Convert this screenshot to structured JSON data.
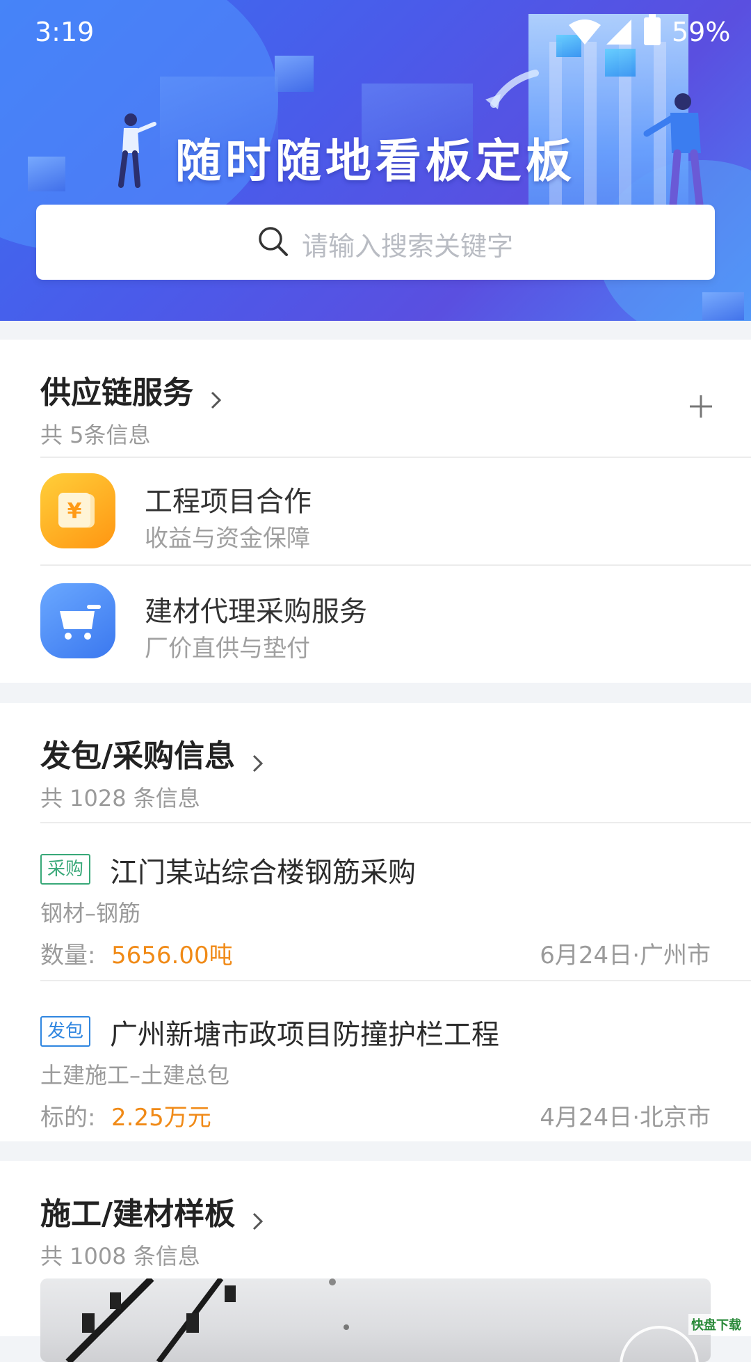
{
  "status": {
    "time": "3:19",
    "battery": "59%"
  },
  "hero": {
    "title": "随时随地看板定板"
  },
  "search": {
    "placeholder": "请输入搜索关键字"
  },
  "supply": {
    "title": "供应链服务",
    "count": "共 5条信息",
    "items": [
      {
        "title": "工程项目合作",
        "subtitle": "收益与资金保障",
        "icon": "yen-icon",
        "color": "#ffa313"
      },
      {
        "title": "建材代理采购服务",
        "subtitle": "厂价直供与垫付",
        "icon": "cart-icon",
        "color": "#4a86f0"
      }
    ]
  },
  "purchase": {
    "title": "发包/采购信息",
    "count": "共 1028 条信息",
    "items": [
      {
        "tag": "采购",
        "title": "江门某站综合楼钢筋采购",
        "category": "钢材–钢筋",
        "qty_label": "数量:",
        "qty_value": "5656.00吨",
        "meta": "6月24日·广州市"
      },
      {
        "tag": "发包",
        "title": "广州新塘市政项目防撞护栏工程",
        "category": "土建施工–土建总包",
        "qty_label": "标的:",
        "qty_value": "2.25万元",
        "meta": "4月24日·北京市"
      }
    ]
  },
  "samples": {
    "title": "施工/建材样板",
    "count": "共 1008 条信息"
  },
  "watermark": "快盘下载",
  "colors": {
    "accent_orange": "#f08a17",
    "tag_green": "#38a878",
    "tag_blue": "#2f86e0",
    "hero_blue": "#4a5bea"
  }
}
